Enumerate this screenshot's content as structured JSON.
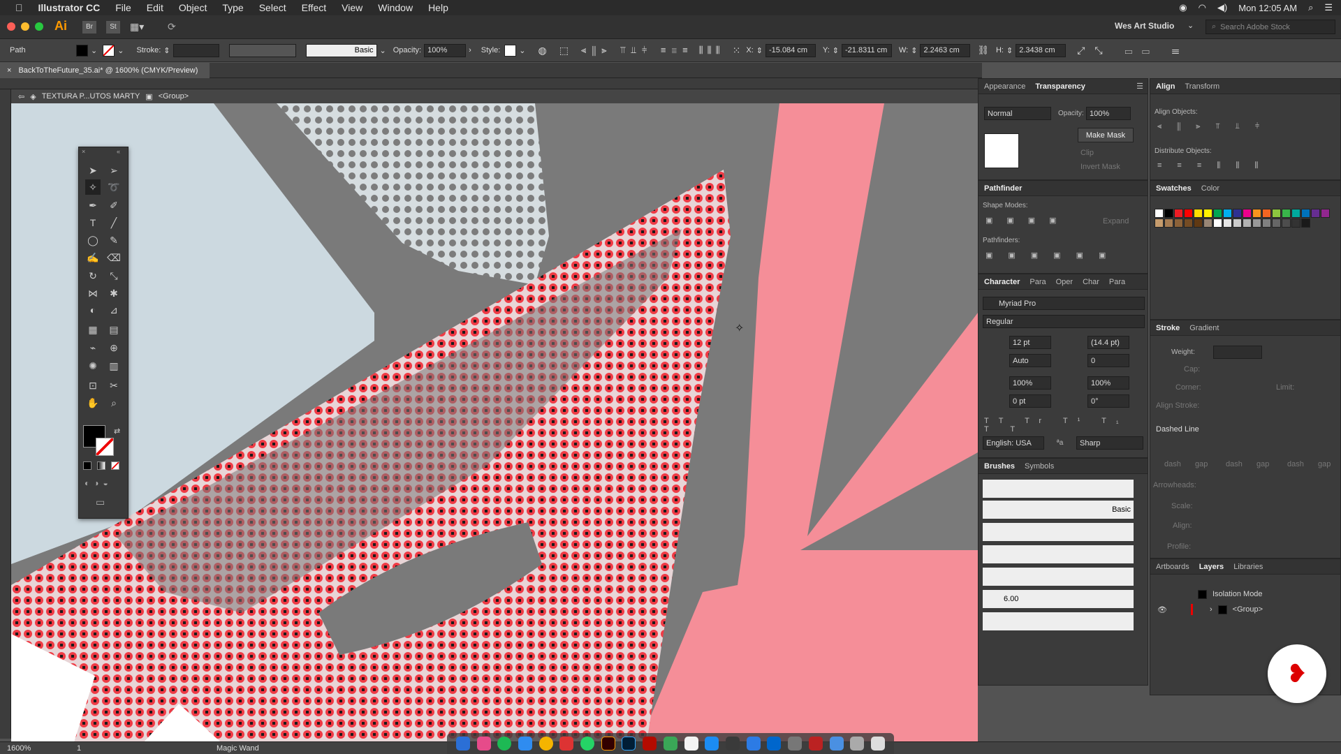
{
  "menubar": {
    "app": "Illustrator CC",
    "items": [
      "File",
      "Edit",
      "Object",
      "Type",
      "Select",
      "Effect",
      "View",
      "Window",
      "Help"
    ],
    "clock": "Mon 12:05 AM"
  },
  "appbar": {
    "workspace": "Wes Art Studio",
    "search_placeholder": "Search Adobe Stock",
    "logo": "Ai",
    "bridge": "Br",
    "stock": "St"
  },
  "control": {
    "selection": "Path",
    "stroke_label": "Stroke:",
    "brush": "Basic",
    "opacity_label": "Opacity:",
    "opacity": "100%",
    "style_label": "Style:",
    "x_label": "X:",
    "x": "-15.084 cm",
    "y_label": "Y:",
    "y": "-21.8311 cm",
    "w_label": "W:",
    "w": "2.2463 cm",
    "h_label": "H:",
    "h": "2.3438 cm"
  },
  "document": {
    "tab": "BackToTheFuture_35.ai* @ 1600% (CMYK/Preview)",
    "crumb_layer": "TEXTURA P...UTOS MARTY",
    "crumb_group": "<Group>"
  },
  "status": {
    "zoom": "1600%",
    "artboard": "1",
    "tool": "Magic Wand"
  },
  "appearance": {
    "tab1": "Appearance",
    "tab2": "Transparency",
    "blend": "Normal",
    "opacity_label": "Opacity:",
    "opacity": "100%",
    "make_mask": "Make Mask",
    "clip": "Clip",
    "invert": "Invert Mask"
  },
  "pathfinder": {
    "title": "Pathfinder",
    "shape_modes": "Shape Modes:",
    "expand": "Expand",
    "pathfinders": "Pathfinders:"
  },
  "character": {
    "tabs": [
      "Character",
      "Para",
      "Oper",
      "Char",
      "Para"
    ],
    "font": "Myriad Pro",
    "style": "Regular",
    "size": "12 pt",
    "leading": "(14.4 pt)",
    "kerning": "Auto",
    "tracking": "0",
    "vscale": "100%",
    "hscale": "100%",
    "baseline": "0 pt",
    "rotate": "0°",
    "language": "English: USA",
    "aa_label": "ªa",
    "aa": "Sharp"
  },
  "brushes": {
    "tab1": "Brushes",
    "tab2": "Symbols",
    "basic": "Basic",
    "size": "6.00"
  },
  "align": {
    "tab1": "Align",
    "tab2": "Transform",
    "align_objects": "Align Objects:",
    "distribute": "Distribute Objects:"
  },
  "swatches": {
    "tab1": "Swatches",
    "tab2": "Color",
    "colors": [
      "#ffffff",
      "#000000",
      "#ed1c24",
      "#ff0000",
      "#ffde00",
      "#fff200",
      "#00a651",
      "#00aeef",
      "#2e3192",
      "#ec008c",
      "#f7941d",
      "#f26522",
      "#8dc63f",
      "#39b54a",
      "#00a99d",
      "#0072bc",
      "#662d91",
      "#92278f",
      "#c69c6d",
      "#a67c52",
      "#8c6239",
      "#754c24",
      "#603913",
      "#998675",
      "#ffffff",
      "#e6e6e6",
      "#cccccc",
      "#b3b3b3",
      "#999999",
      "#808080",
      "#666666",
      "#4d4d4d",
      "#333333",
      "#1a1a1a"
    ]
  },
  "stroke": {
    "tab1": "Stroke",
    "tab2": "Gradient",
    "weight": "Weight:",
    "cap": "Cap:",
    "corner": "Corner:",
    "limit": "Limit:",
    "align": "Align Stroke:",
    "dashed": "Dashed Line",
    "dash": "dash",
    "gap": "gap",
    "arrowheads": "Arrowheads:",
    "scale": "Scale:",
    "align2": "Align:",
    "profile": "Profile:"
  },
  "layers": {
    "tabs": [
      "Artboards",
      "Layers",
      "Libraries"
    ],
    "items": [
      "Isolation Mode",
      "<Group>"
    ]
  }
}
